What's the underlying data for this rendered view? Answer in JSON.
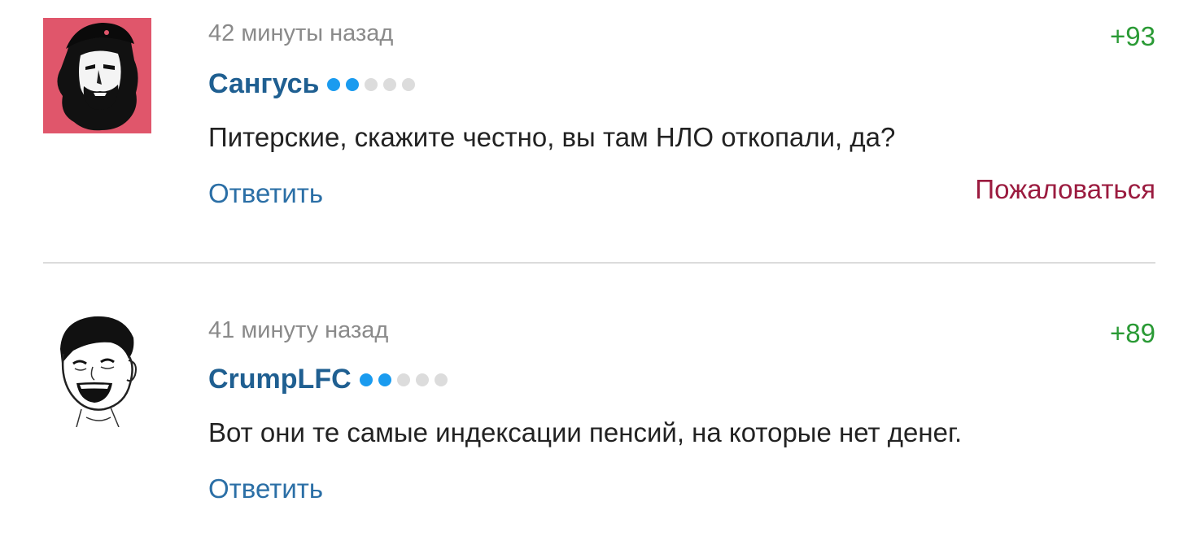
{
  "comments": [
    {
      "time": "42 минуты назад",
      "author": "Сангусь",
      "rating_dots": [
        true,
        true,
        false,
        false,
        false
      ],
      "score": "+93",
      "text": "Питерские, скажите честно, вы там НЛО откопали, да?",
      "reply_label": "Ответить",
      "complain_label": "Пожаловаться",
      "avatar": "che-guevara-portrait-icon"
    },
    {
      "time": "41 минуту назад",
      "author": "CrumpLFC",
      "rating_dots": [
        true,
        true,
        false,
        false,
        false
      ],
      "score": "+89",
      "text": "Вот они те самые индексации пенсий, на которые нет денег.",
      "reply_label": "Ответить",
      "avatar": "laughing-meme-face-icon"
    }
  ],
  "colors": {
    "author": "#1f5f91",
    "score": "#2a9a35",
    "reply": "#2b6fa6",
    "complain": "#9b1b3f",
    "dot_on": "#1a9bef",
    "dot_off": "#dcdcdc"
  }
}
